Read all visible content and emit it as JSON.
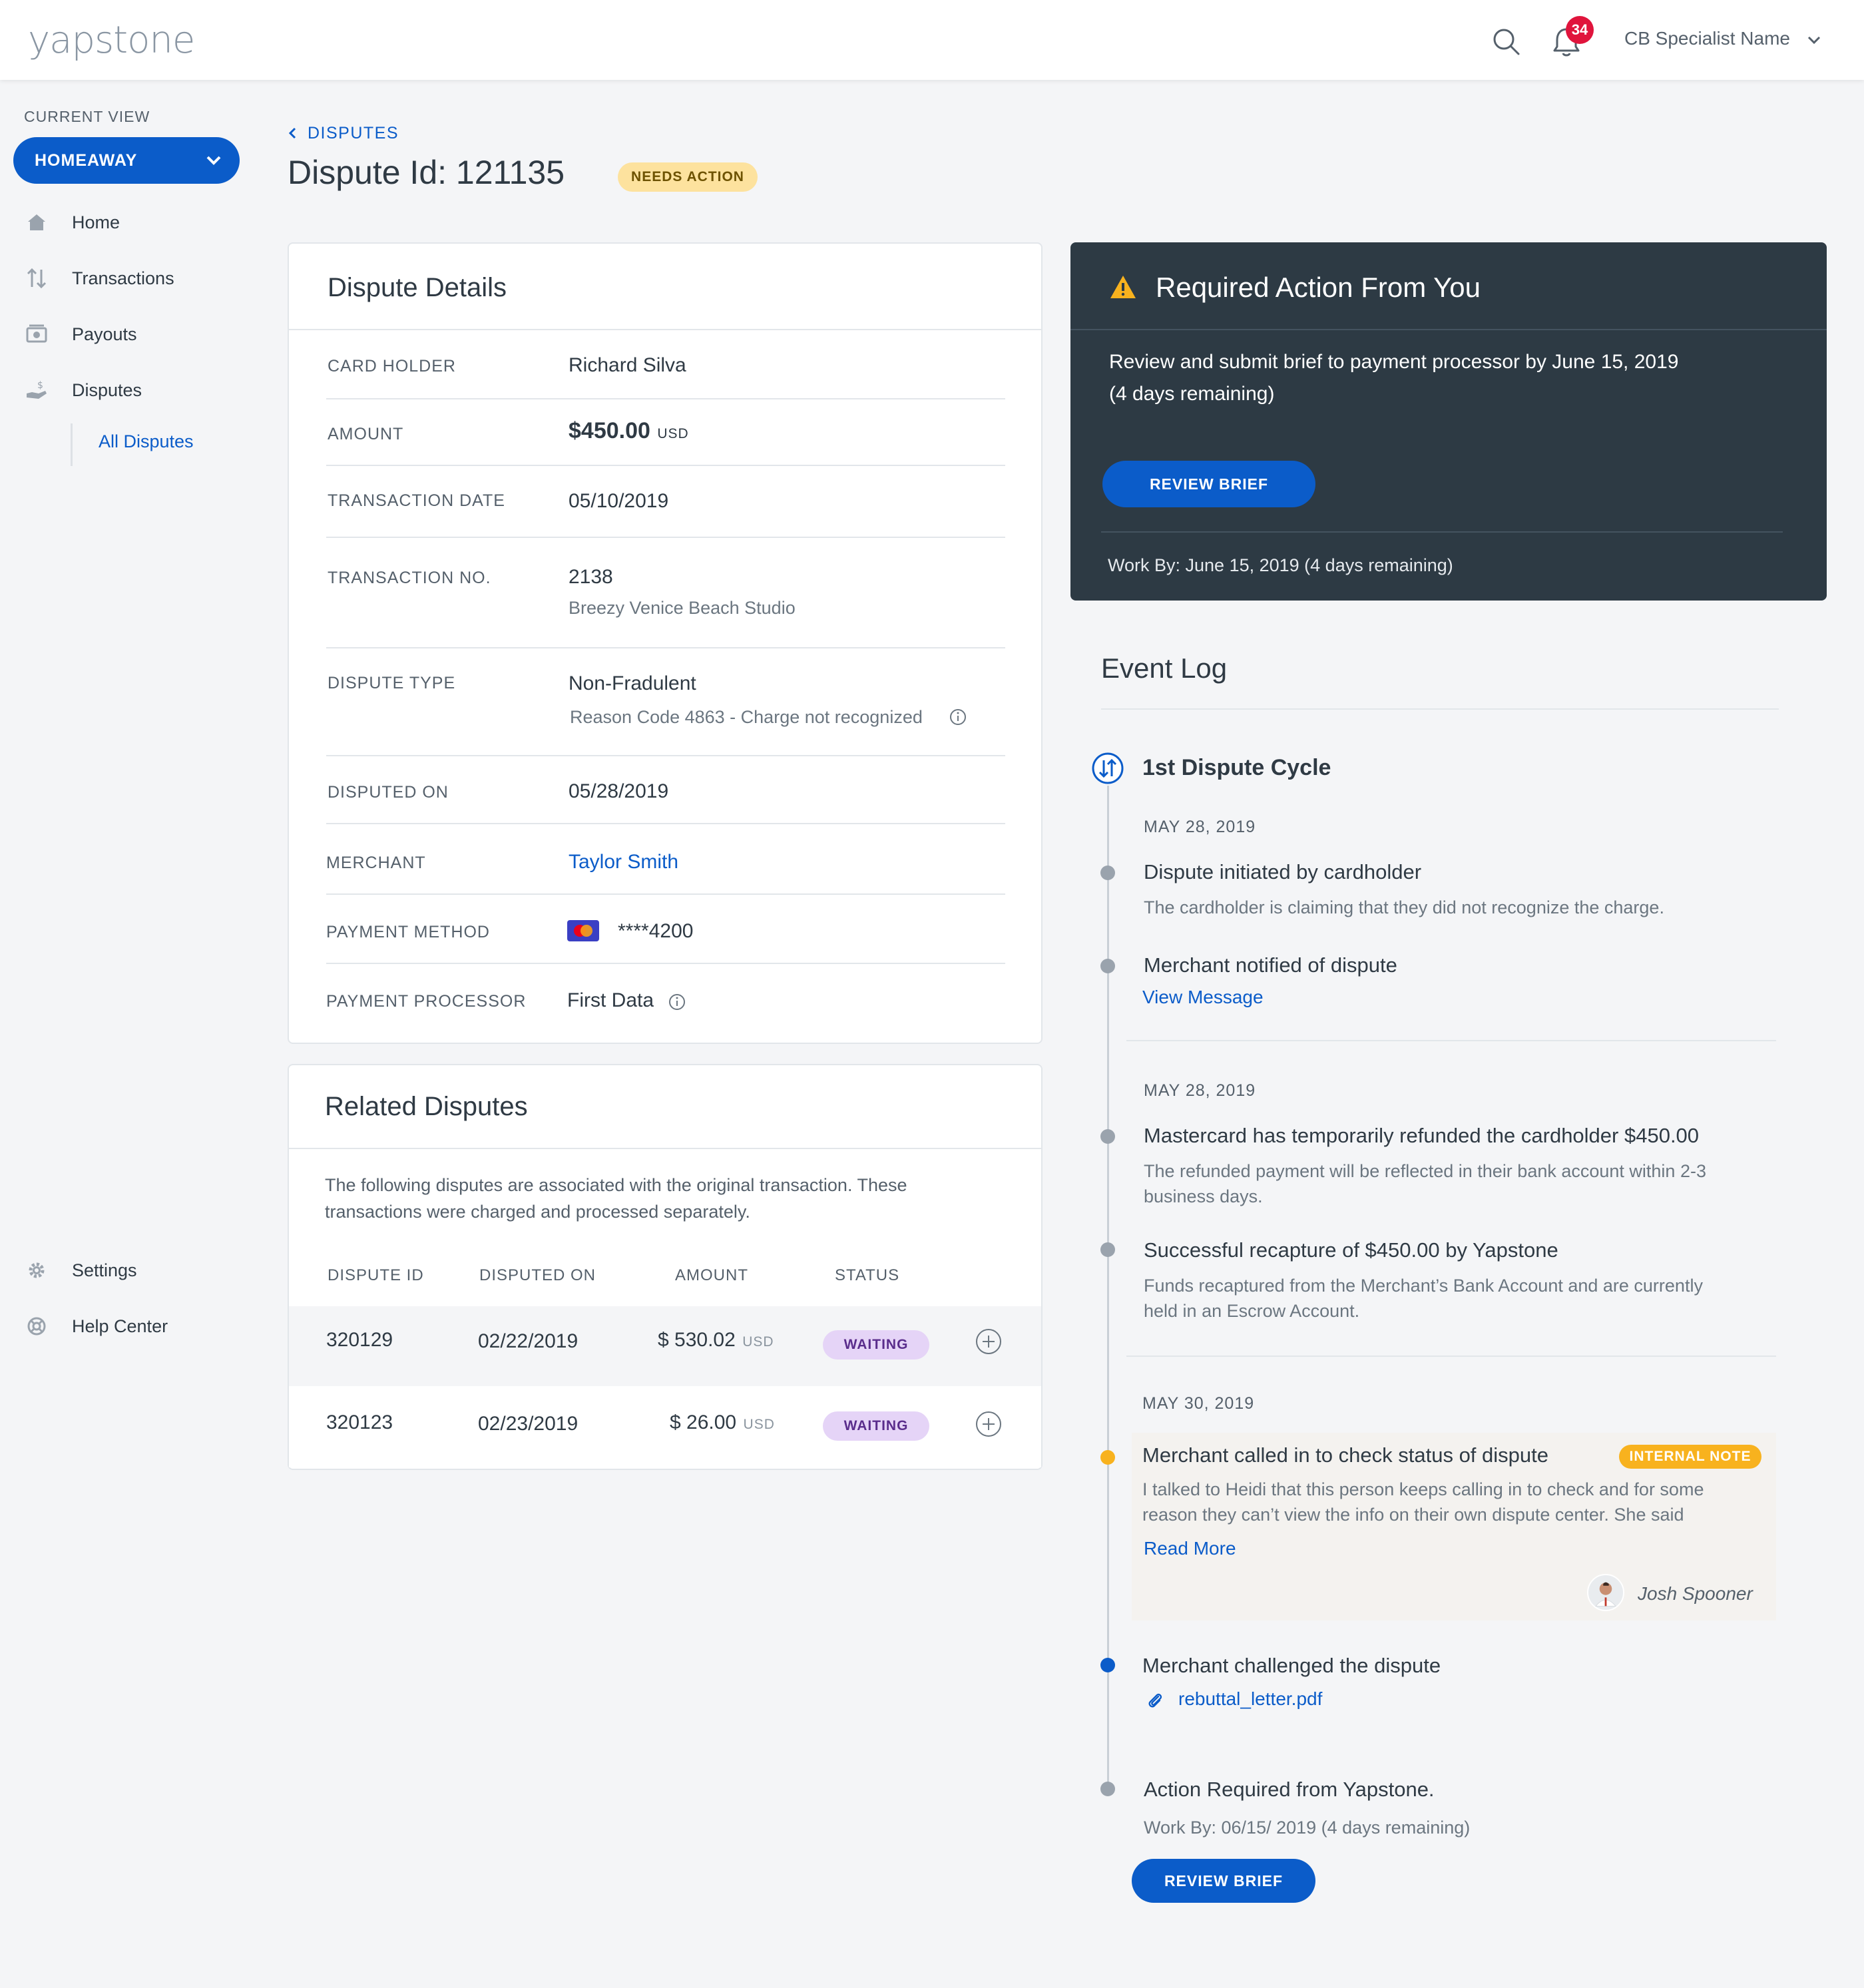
{
  "app": {
    "logo": "yapstone"
  },
  "topbar": {
    "notification_count": "34",
    "user_name": "CB Specialist Name"
  },
  "sidebar": {
    "current_view_label": "CURRENT VIEW",
    "current_view_value": "HOMEAWAY",
    "items": [
      {
        "label": "Home",
        "icon": "home-icon"
      },
      {
        "label": "Transactions",
        "icon": "arrows-icon"
      },
      {
        "label": "Payouts",
        "icon": "cash-icon"
      },
      {
        "label": "Disputes",
        "icon": "hand-dollar-icon"
      }
    ],
    "sub_item": "All Disputes",
    "bottom_items": [
      {
        "label": "Settings",
        "icon": "gear-icon"
      },
      {
        "label": "Help Center",
        "icon": "lifebuoy-icon"
      }
    ]
  },
  "header": {
    "breadcrumb": "DISPUTES",
    "title": "Dispute Id: 121135",
    "status": "NEEDS ACTION"
  },
  "details": {
    "title": "Dispute Details",
    "card_holder_label": "CARD HOLDER",
    "card_holder": "Richard Silva",
    "amount_label": "AMOUNT",
    "amount": "$450.00",
    "amount_currency": "USD",
    "transaction_date_label": "TRANSACTION DATE",
    "transaction_date": "05/10/2019",
    "transaction_no_label": "TRANSACTION NO.",
    "transaction_no": "2138",
    "transaction_property": "Breezy Venice Beach Studio",
    "dispute_type_label": "DISPUTE TYPE",
    "dispute_type": "Non-Fradulent",
    "reason_code": "Reason Code 4863 - Charge not recognized",
    "disputed_on_label": "DISPUTED ON",
    "disputed_on": "05/28/2019",
    "merchant_label": "MERCHANT",
    "merchant": "Taylor Smith",
    "payment_method_label": "PAYMENT METHOD",
    "payment_method": "****4200",
    "payment_processor_label": "PAYMENT PROCESSOR",
    "payment_processor": "First Data"
  },
  "related": {
    "title": "Related Disputes",
    "description_line1": "The following disputes are associated with the original transaction. These",
    "description_line2": "transactions were charged and processed separately.",
    "columns": [
      "DISPUTE ID",
      "DISPUTED ON",
      "AMOUNT",
      "STATUS"
    ],
    "rows": [
      {
        "id": "320129",
        "disputed_on": "02/22/2019",
        "amount": "$ 530.02",
        "currency": "USD",
        "status": "WAITING"
      },
      {
        "id": "320123",
        "disputed_on": "02/23/2019",
        "amount": "$ 26.00",
        "currency": "USD",
        "status": "WAITING"
      }
    ]
  },
  "required_action": {
    "title": "Required Action From You",
    "line1": "Review and submit brief to payment processor by June 15, 2019",
    "line2": "(4 days remaining)",
    "button": "REVIEW BRIEF",
    "work_by": "Work By: June 15, 2019 (4 days remaining)"
  },
  "event_log": {
    "title": "Event Log",
    "cycle": "1st Dispute Cycle",
    "groups": [
      {
        "date": "MAY 28, 2019",
        "events": [
          {
            "title": "Dispute initiated by cardholder",
            "desc": "The cardholder is claiming that they did not recognize the charge."
          },
          {
            "title": "Merchant notified of dispute",
            "link": "View Message"
          }
        ]
      },
      {
        "date": "MAY 28, 2019",
        "events": [
          {
            "title": "Mastercard has temporarily refunded the cardholder $450.00",
            "desc1": "The refunded payment will be reflected in their bank account within 2-3",
            "desc2": "business days."
          },
          {
            "title": "Successful recapture of $450.00 by Yapstone",
            "desc1": "Funds recaptured from the Merchant’s Bank Account and are currently",
            "desc2": "held in an Escrow Account."
          }
        ]
      },
      {
        "date": "MAY 30, 2019",
        "events": [
          {
            "title": "Merchant called in to check status of dispute",
            "badge": "INTERNAL NOTE",
            "desc1": "I talked to Heidi that this person keeps calling in to check and for some",
            "desc2": "reason they can’t view the info on their own dispute center. She said",
            "link": "Read More",
            "author": "Josh Spooner"
          },
          {
            "title": "Merchant challenged the dispute",
            "attachment": "rebuttal_letter.pdf"
          },
          {
            "title": "Action Required from Yapstone.",
            "desc": "Work By: 06/15/ 2019 (4 days remaining)",
            "button": "REVIEW BRIEF"
          }
        ]
      }
    ]
  },
  "colors": {
    "primary": "#0b5cc9",
    "dark_card": "#2d3a44",
    "needs_action": "#fde29e",
    "waiting": "#e5d4f7",
    "internal_note": "#f8b21e",
    "notification": "#e0143c"
  }
}
